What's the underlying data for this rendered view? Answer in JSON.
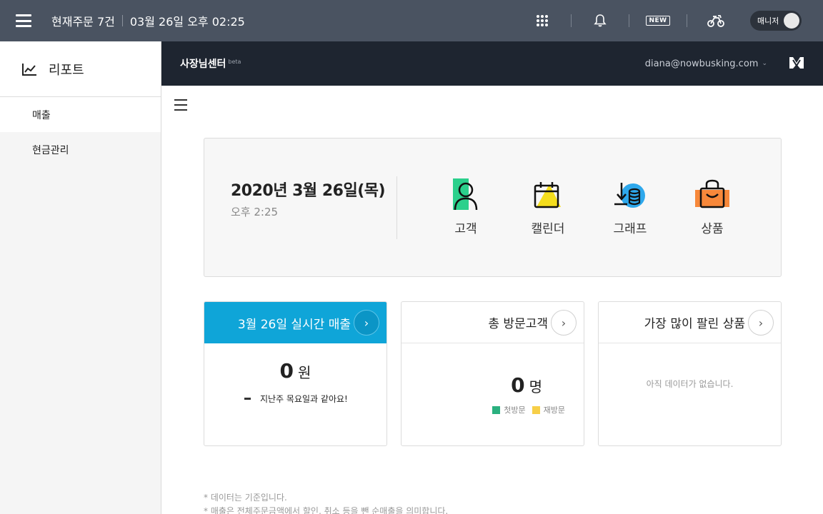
{
  "topbar": {
    "orders": "현재주문 7건",
    "datetime": "03월 26일 오후 02:25",
    "new_badge": "NEW",
    "manager_label": "매니저"
  },
  "sidebar": {
    "title": "리포트",
    "items": [
      {
        "label": "매출",
        "active": true
      },
      {
        "label": "현금관리",
        "active": false
      }
    ]
  },
  "header": {
    "title": "사장님센터",
    "beta": "beta",
    "email": "diana@nowbusking.com"
  },
  "summary": {
    "date": "2020년 3월 26일(목)",
    "time": "오후 2:25",
    "shortcuts": [
      {
        "label": "고객",
        "icon": "customer-icon"
      },
      {
        "label": "캘린더",
        "icon": "calendar-icon"
      },
      {
        "label": "그래프",
        "icon": "graph-icon"
      },
      {
        "label": "상품",
        "icon": "product-bag-icon"
      }
    ]
  },
  "cards": {
    "sales": {
      "title": "3월 26일 실시간 매출",
      "value": "0",
      "unit": "원",
      "compare": "지난주 목요일과 같아요!"
    },
    "visitors": {
      "title": "총 방문고객",
      "value": "0",
      "unit": "명",
      "legend": [
        {
          "label": "첫방문",
          "color": "#2bb07f"
        },
        {
          "label": "재방문",
          "color": "#f7cf48"
        }
      ]
    },
    "top_products": {
      "title": "가장 많이 팔린 상품",
      "empty": "아직 데이터가 없습니다."
    }
  },
  "notes": [
    "* 데이터는 기준입니다.",
    "* 매출은 전체주문금액에서 할인, 취소 등을 뺀 순매출을 의미합니다."
  ]
}
